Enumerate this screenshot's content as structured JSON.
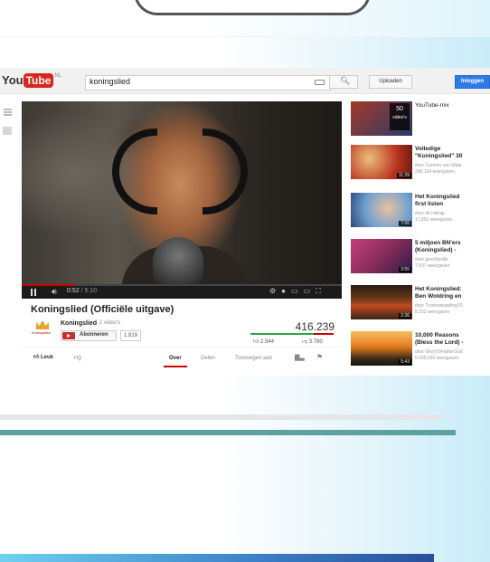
{
  "header": {
    "logo_you": "You",
    "logo_tube": "Tube",
    "logo_region": "NL",
    "search_value": "koningslied",
    "upload_label": "Uploaden",
    "login_label": "Inloggen"
  },
  "player": {
    "current_time": "0:52",
    "duration": "/ 5:10",
    "progress": 0.168
  },
  "video": {
    "title": "Koningslied (Officiële uitgave)",
    "channel_name": "Koningslied",
    "channel_videos": "· 2 video's",
    "channel_logo_text": "Koningslied",
    "subscribe_label": "Abonneren",
    "subscriber_count": "1.919",
    "views": "416.239",
    "likes": "2.544",
    "dislikes": "3.780",
    "like_label": "Leuk",
    "tabs": [
      "Over",
      "Delen",
      "Toevoegen aan"
    ]
  },
  "sidebar": {
    "mix_count": "50",
    "mix_count_label": "video's",
    "mix_title": "YouTube-mix",
    "items": [
      {
        "title": "Volledige\n\"Koningslied\" 30",
        "channel": "door Carmen van Wala",
        "views": "298.134 weergaven",
        "duration": "11:39",
        "color": "#b9321f"
      },
      {
        "title": "Het Koningslied\nfirst listen",
        "channel": "door rik rottrap",
        "views": "17.891 weergaven",
        "duration": "7:06",
        "color": "#6f9fd0"
      },
      {
        "title": "5 miljoen BN'ers\n(Koningslied) -",
        "channel": "door geenfamilie",
        "views": "7.597 weergaven",
        "duration": "3:55",
        "color": "#8a2c5a"
      },
      {
        "title": "Het Koningslied:\nBen Woldring en",
        "channel": "door Troonswisseling20",
        "views": "8.222 weergaven",
        "duration": "2:36",
        "color": "#3a2418"
      },
      {
        "title": "10,000 Reasons\n(Bless the Lord) -",
        "channel": "door GloryToFatherGod",
        "views": "5.509.030 weergaven",
        "duration": "5:43",
        "color": "#e57a1d"
      }
    ]
  }
}
